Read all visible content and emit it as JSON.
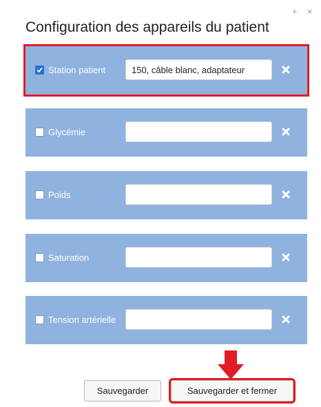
{
  "window_controls": {
    "plus": "+",
    "close": "×"
  },
  "title": "Configuration des appareils du patient",
  "devices": [
    {
      "label": "Station patient",
      "checked": true,
      "value": "150, câble blanc, adaptateur",
      "highlighted": true
    },
    {
      "label": "Glycémie",
      "checked": false,
      "value": ""
    },
    {
      "label": "Poids",
      "checked": false,
      "value": ""
    },
    {
      "label": "Saturation",
      "checked": false,
      "value": ""
    },
    {
      "label": "Tension artérielle",
      "checked": false,
      "value": ""
    }
  ],
  "buttons": {
    "save": "Sauvegarder",
    "save_close": "Sauvegarder et fermer"
  },
  "colors": {
    "row_bg": "#8fb3de",
    "highlight": "#e01b24",
    "checkbox_checked": "#1e73d8"
  },
  "icons": {
    "delete": "close-icon",
    "annotation": "arrow-down-icon"
  }
}
